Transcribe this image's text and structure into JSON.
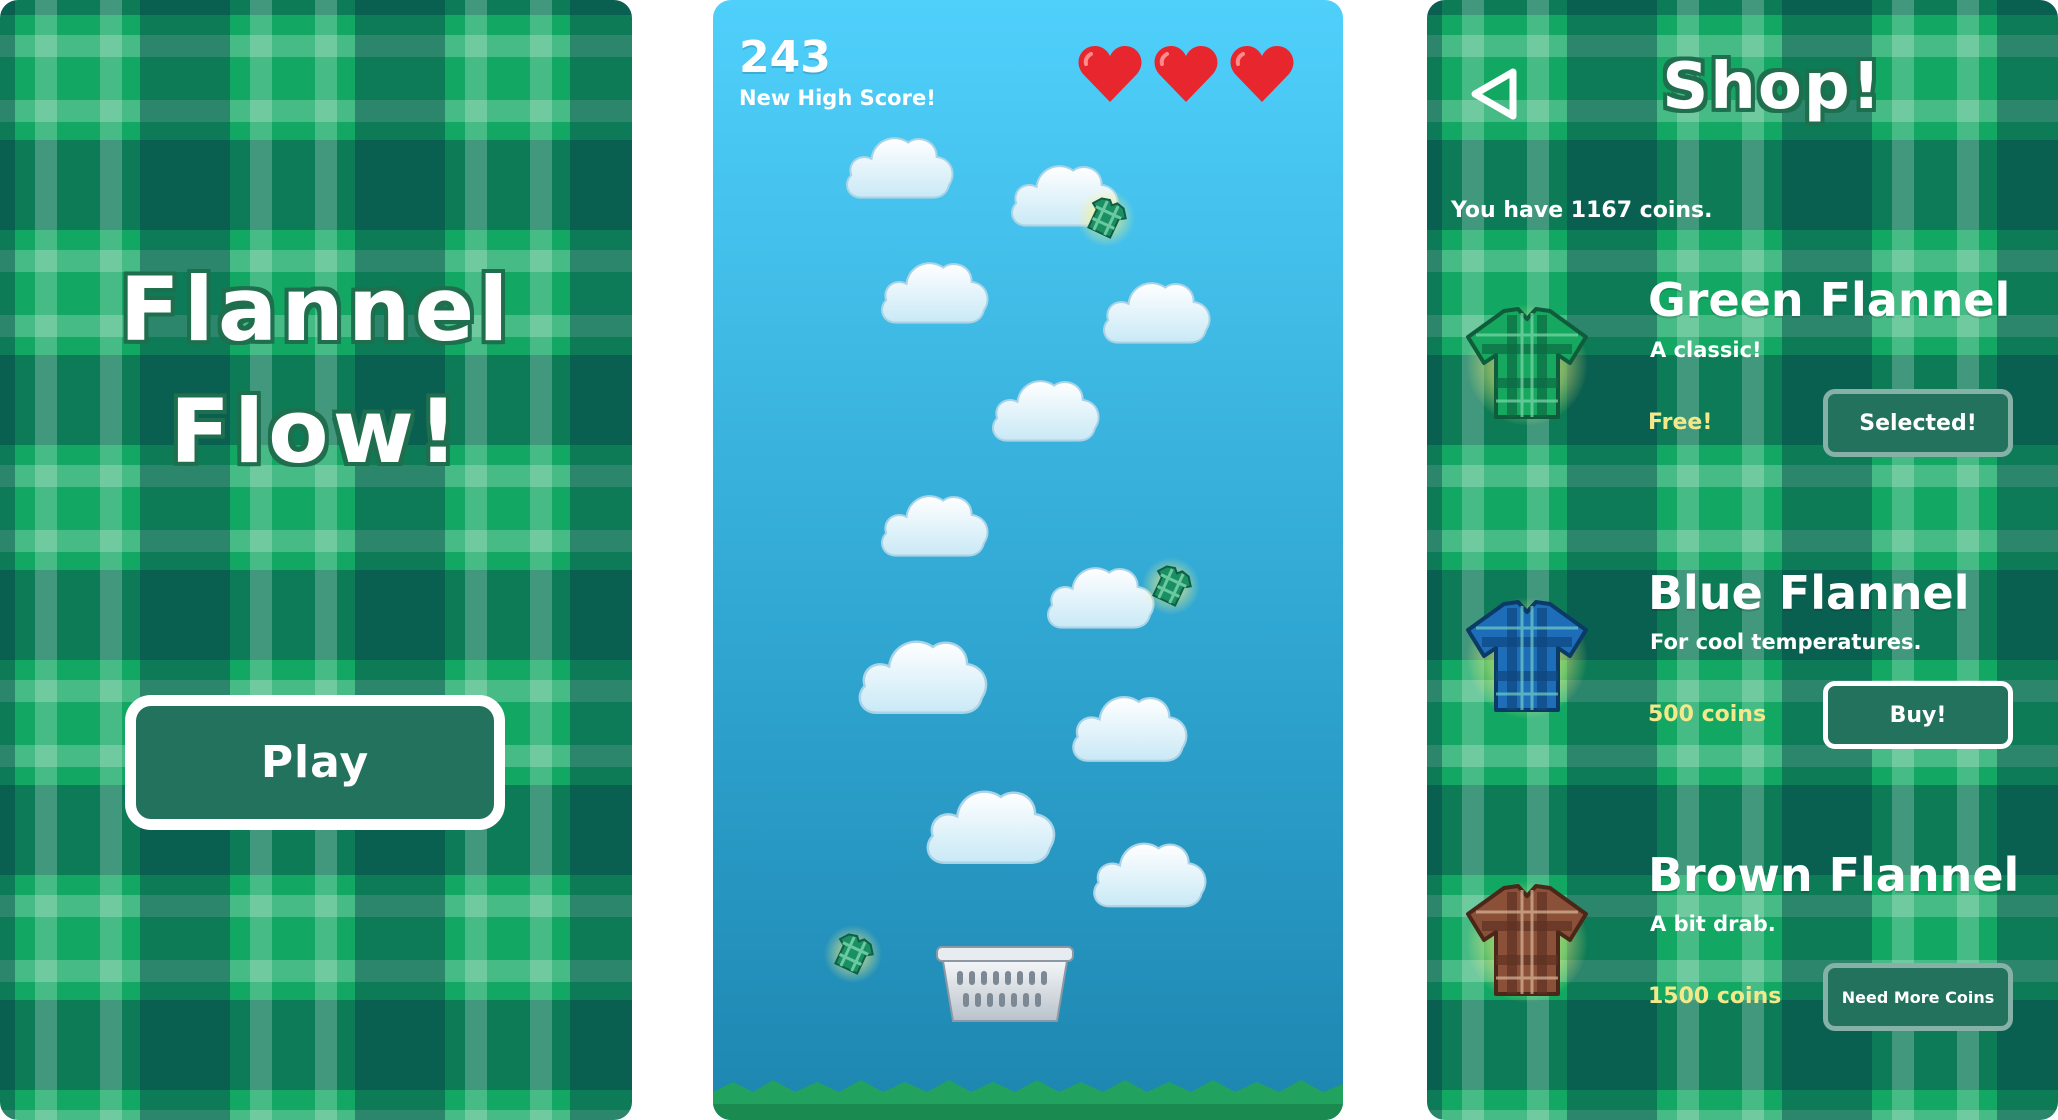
{
  "title_screen": {
    "title_line1": "Flannel",
    "title_line2": "Flow!",
    "play_label": "Play"
  },
  "game_screen": {
    "score": "243",
    "high_score_label": "New High Score!",
    "lives": 3,
    "colors": {
      "sky_top": "#4fd0fb",
      "sky_bottom": "#1d86b0",
      "heart": "#e8262e",
      "grass": "#21a35f"
    }
  },
  "shop_screen": {
    "title": "Shop!",
    "coins_text": "You have 1167 coins.",
    "items": [
      {
        "name": "Green Flannel",
        "description": "A classic!",
        "price": "Free!",
        "button": "Selected!",
        "color": "#16a85f"
      },
      {
        "name": "Blue Flannel",
        "description": "For cool temperatures.",
        "price": "500 coins",
        "button": "Buy!",
        "color": "#1d6db8"
      },
      {
        "name": "Brown Flannel",
        "description": "A bit drab.",
        "price": "1500 coins",
        "button": "Need More Coins",
        "color": "#8a5038"
      }
    ]
  },
  "colors": {
    "plaid_base": "#12a863",
    "button_fill": "#23725d",
    "price_text": "#f3e98a"
  }
}
